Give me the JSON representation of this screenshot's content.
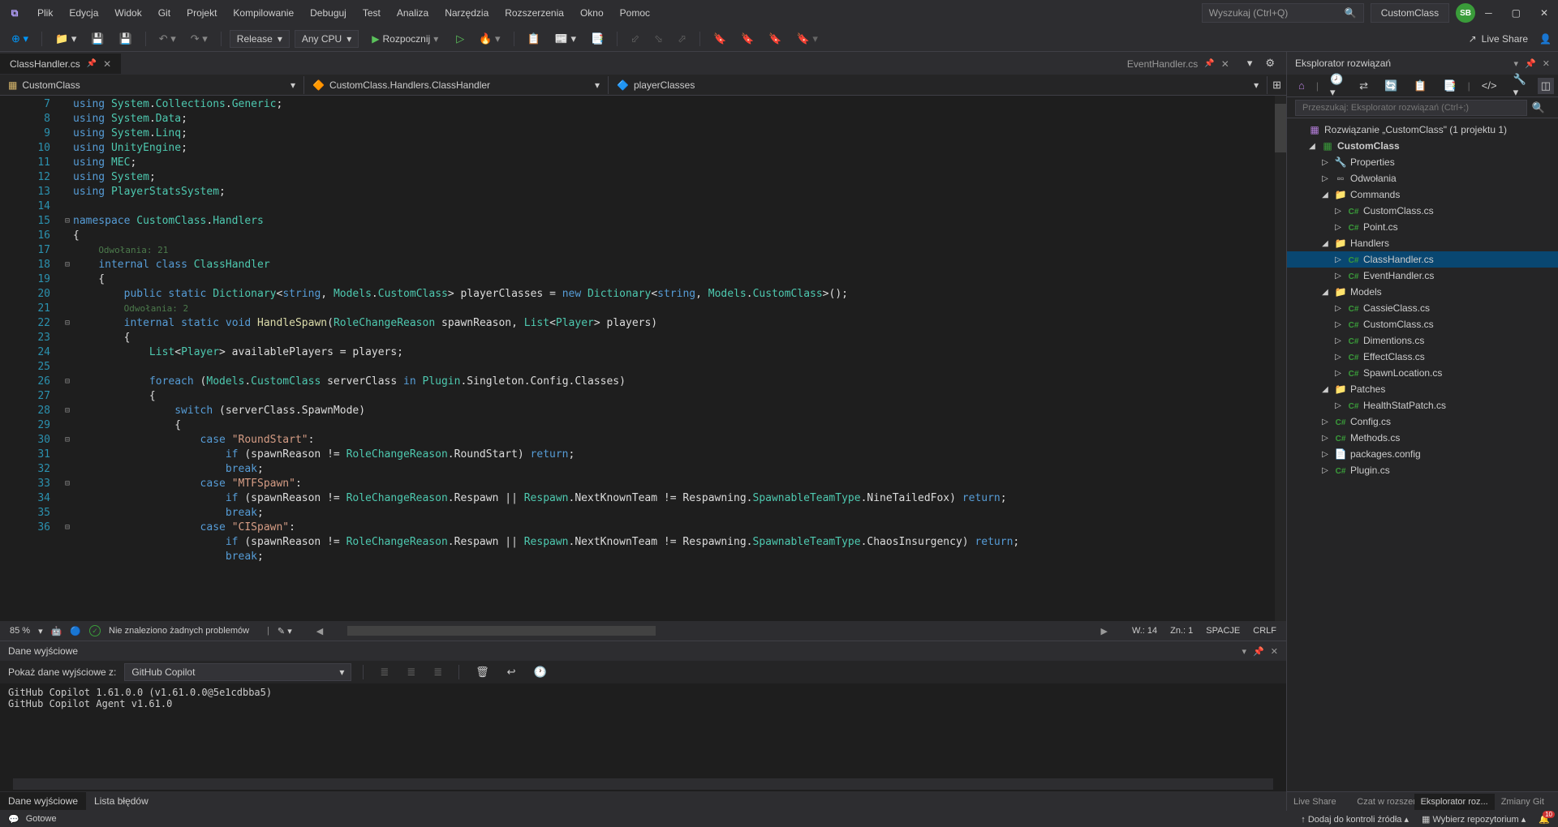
{
  "titlebar": {
    "menus": [
      "Plik",
      "Edycja",
      "Widok",
      "Git",
      "Projekt",
      "Kompilowanie",
      "Debuguj",
      "Test",
      "Analiza",
      "Narzędzia",
      "Rozszerzenia",
      "Okno",
      "Pomoc"
    ],
    "search_placeholder": "Wyszukaj (Ctrl+Q)",
    "project_name": "CustomClass",
    "user_initials": "SB"
  },
  "toolbar": {
    "config": "Release",
    "platform": "Any CPU",
    "start_label": "Rozpocznij",
    "live_share": "Live Share"
  },
  "tabs": {
    "left_tab": "ClassHandler.cs",
    "right_tab": "EventHandler.cs"
  },
  "navbar": {
    "class_dropdown": "CustomClass",
    "member_dropdown": "CustomClass.Handlers.ClassHandler",
    "field_dropdown": "playerClasses"
  },
  "code_lines": [
    7,
    8,
    9,
    10,
    11,
    12,
    13,
    14,
    15,
    16,
    "",
    17,
    18,
    19,
    "",
    20,
    21,
    22,
    23,
    24,
    25,
    26,
    27,
    28,
    29,
    30,
    31,
    32,
    33,
    34,
    35,
    36
  ],
  "hints": {
    "refs1": "Odwołania: 21",
    "refs2": "Odwołania: 2"
  },
  "editor_status": {
    "zoom": "85 %",
    "no_problems": "Nie znaleziono żadnych problemów",
    "ln": "W.: 14",
    "col": "Zn.: 1",
    "spaces": "SPACJE",
    "eol": "CRLF"
  },
  "output": {
    "panel_title": "Dane wyjściowe",
    "source_label": "Pokaż dane wyjściowe z:",
    "source_value": "GitHub Copilot",
    "lines": [
      "GitHub Copilot 1.61.0.0 (v1.61.0.0@5e1cdbba5)",
      "GitHub Copilot Agent v1.61.0"
    ],
    "bottom_tabs": [
      "Dane wyjściowe",
      "Lista błędów"
    ]
  },
  "solution": {
    "title": "Eksplorator rozwiązań",
    "search_placeholder": "Przeszukaj: Eksplorator rozwiązań (Ctrl+;)",
    "root": "Rozwiązanie „CustomClass\" (1 projektu 1)",
    "project": "CustomClass",
    "nodes": {
      "properties": "Properties",
      "references": "Odwołania",
      "commands": "Commands",
      "commands_children": [
        "CustomClass.cs",
        "Point.cs"
      ],
      "handlers": "Handlers",
      "handlers_children": [
        "ClassHandler.cs",
        "EventHandler.cs"
      ],
      "models": "Models",
      "models_children": [
        "CassieClass.cs",
        "CustomClass.cs",
        "Dimentions.cs",
        "EffectClass.cs",
        "SpawnLocation.cs"
      ],
      "patches": "Patches",
      "patches_children": [
        "HealthStatPatch.cs"
      ],
      "files": [
        "Config.cs",
        "Methods.cs",
        "packages.config",
        "Plugin.cs"
      ]
    },
    "bottom_tabs": [
      "Live Share",
      "Czat w rozszerz...",
      "Eksplorator roz...",
      "Zmiany Git"
    ]
  },
  "statusbar": {
    "ready": "Gotowe",
    "source_control": "Dodaj do kontroli źródła",
    "repo": "Wybierz repozytorium",
    "notifications": "10"
  }
}
